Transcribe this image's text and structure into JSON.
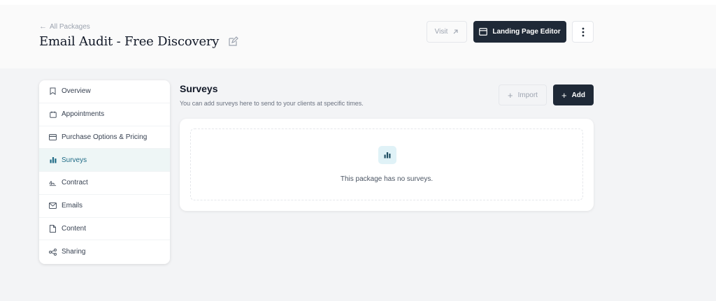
{
  "header": {
    "back_label": "All Packages",
    "title": "Email Audit - Free Discovery",
    "visit_label": "Visit",
    "landing_editor_label": "Landing Page Editor"
  },
  "sidebar": {
    "items": [
      {
        "label": "Overview",
        "icon": "bookmark-icon"
      },
      {
        "label": "Appointments",
        "icon": "calendar-icon"
      },
      {
        "label": "Purchase Options & Pricing",
        "icon": "credit-card-icon"
      },
      {
        "label": "Surveys",
        "icon": "bar-chart-icon",
        "active": true
      },
      {
        "label": "Contract",
        "icon": "signature-icon"
      },
      {
        "label": "Emails",
        "icon": "mail-icon"
      },
      {
        "label": "Content",
        "icon": "file-icon"
      },
      {
        "label": "Sharing",
        "icon": "share-icon"
      }
    ]
  },
  "main": {
    "title": "Surveys",
    "subtitle": "You can add surveys here to send to your clients at specific times.",
    "import_label": "Import",
    "add_label": "Add",
    "empty_text": "This package has no surveys."
  },
  "colors": {
    "accent_dark": "#1f2937",
    "active_bg": "#eef6f6",
    "active_text": "#1f6b86",
    "empty_icon_bg": "#e0f2f7"
  }
}
